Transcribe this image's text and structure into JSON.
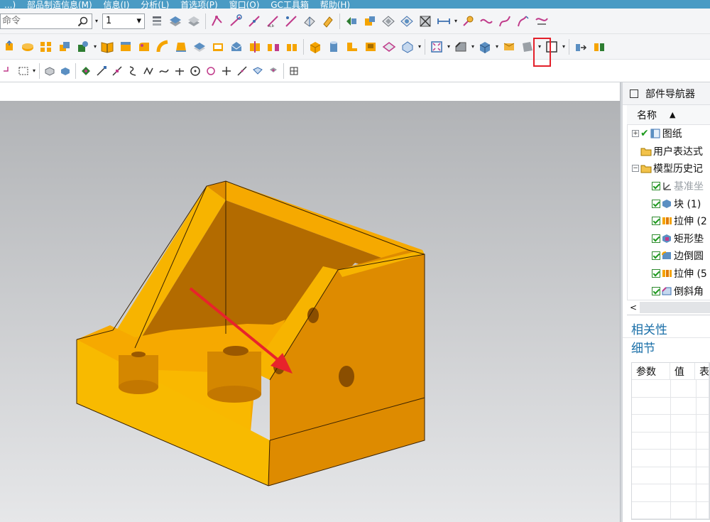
{
  "menu": [
    "...)",
    "部品制造信息(M)",
    "信息(I)",
    "分析(L)",
    "首选项(P)",
    "窗口(O)",
    "GC工具箱",
    "帮助(H)"
  ],
  "toolbar": {
    "command_placeholder": "命令",
    "layer_value": "1",
    "highlight_color": "#e3202a"
  },
  "model": {
    "body_color": "#f5a400",
    "arrow_color": "#e8232b"
  },
  "panel": {
    "title": "部件导航器",
    "name_header": "名称",
    "tree": [
      {
        "label": "图纸",
        "expander": "+",
        "check": "green-tick",
        "icon": "drawing-icon",
        "level": 0
      },
      {
        "label": "用户表达式",
        "expander": "",
        "check": "",
        "icon": "folder-icon",
        "level": 0
      },
      {
        "label": "模型历史记",
        "expander": "−",
        "check": "",
        "icon": "folder-icon",
        "level": 0
      },
      {
        "label": "基准坐",
        "check": "checkbox",
        "icon": "datum-csys-icon",
        "level": 1,
        "greyed": true
      },
      {
        "label": "块 (1)",
        "check": "checkbox",
        "icon": "block-icon",
        "level": 1
      },
      {
        "label": "拉伸 (2",
        "check": "checkbox",
        "icon": "extrude-icon",
        "level": 1
      },
      {
        "label": "矩形垫",
        "check": "checkbox",
        "icon": "pad-icon",
        "level": 1
      },
      {
        "label": "边倒圆",
        "check": "checkbox",
        "icon": "edge-blend-icon",
        "level": 1
      },
      {
        "label": "拉伸 (5",
        "check": "checkbox",
        "icon": "extrude-icon",
        "level": 1
      },
      {
        "label": "倒斜角",
        "check": "checkbox",
        "icon": "chamfer-icon",
        "level": 1
      }
    ],
    "dependencies": "相关性",
    "details": "细节",
    "details_headers": [
      "参数",
      "值",
      "表"
    ]
  }
}
